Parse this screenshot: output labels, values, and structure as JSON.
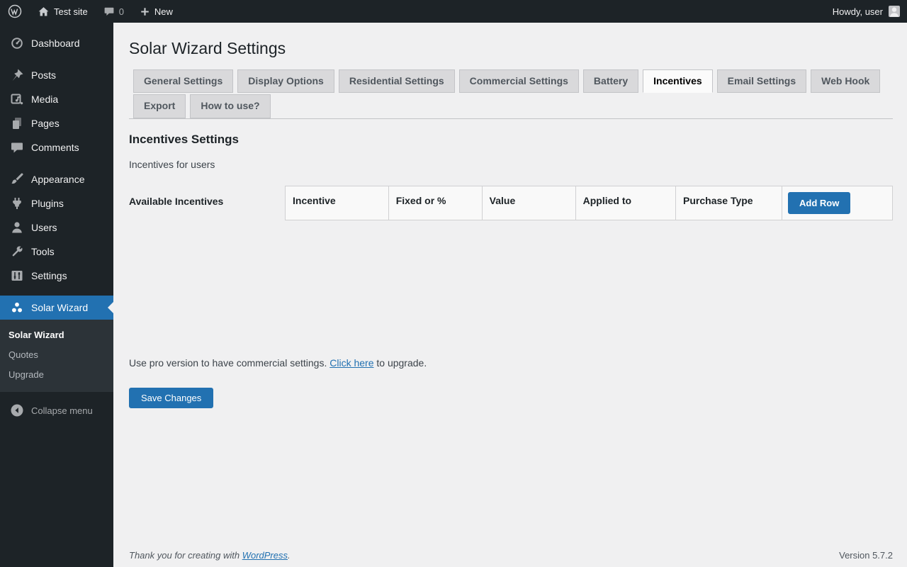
{
  "admin_bar": {
    "site_name": "Test site",
    "comments_count": "0",
    "new_label": "New",
    "howdy": "Howdy, user"
  },
  "sidebar": {
    "groups": [
      {
        "items": [
          {
            "label": "Dashboard",
            "icon": "dashboard-icon"
          }
        ]
      },
      {
        "items": [
          {
            "label": "Posts",
            "icon": "posts-icon"
          },
          {
            "label": "Media",
            "icon": "media-icon"
          },
          {
            "label": "Pages",
            "icon": "pages-icon"
          },
          {
            "label": "Comments",
            "icon": "comments-icon"
          }
        ]
      },
      {
        "items": [
          {
            "label": "Appearance",
            "icon": "appearance-icon"
          },
          {
            "label": "Plugins",
            "icon": "plugins-icon"
          },
          {
            "label": "Users",
            "icon": "users-icon"
          },
          {
            "label": "Tools",
            "icon": "tools-icon"
          },
          {
            "label": "Settings",
            "icon": "settings-icon"
          }
        ]
      }
    ],
    "solar": {
      "label": "Solar Wizard",
      "submenu": [
        {
          "label": "Solar Wizard",
          "current": true
        },
        {
          "label": "Quotes"
        },
        {
          "label": "Upgrade"
        }
      ]
    },
    "collapse_label": "Collapse menu"
  },
  "main": {
    "title": "Solar Wizard Settings",
    "tabs": [
      {
        "label": "General Settings"
      },
      {
        "label": "Display Options"
      },
      {
        "label": "Residential Settings"
      },
      {
        "label": "Commercial Settings"
      },
      {
        "label": "Battery"
      },
      {
        "label": "Incentives",
        "active": true
      },
      {
        "label": "Email Settings"
      },
      {
        "label": "Web Hook"
      },
      {
        "label": "Export"
      },
      {
        "label": "How to use?"
      }
    ],
    "section": {
      "heading": "Incentives Settings",
      "description": "Incentives for users",
      "field_label": "Available Incentives",
      "table_headers": [
        "Incentive",
        "Fixed or %",
        "Value",
        "Applied to",
        "Purchase Type"
      ],
      "add_row_label": "Add Row"
    },
    "upgrade_note": {
      "pre": "Use pro version to have commercial settings. ",
      "link": "Click here",
      "post": " to upgrade."
    },
    "save_label": "Save Changes"
  },
  "footer": {
    "thanks_pre": "Thank you for creating with ",
    "thanks_link": "WordPress",
    "thanks_post": ".",
    "version": "Version 5.7.2"
  },
  "colors": {
    "accent": "#2271b1",
    "admin_bar_bg": "#1d2327",
    "submenu_bg": "#2c3338",
    "content_bg": "#f0f0f1"
  }
}
